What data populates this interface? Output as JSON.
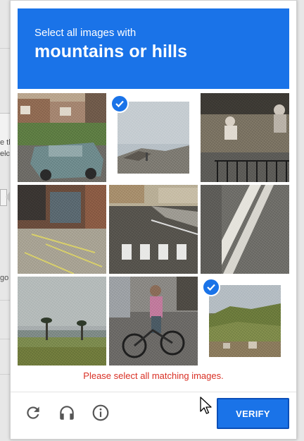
{
  "background": {
    "fragments": [
      "e th",
      "elc",
      "go"
    ]
  },
  "captcha": {
    "header": {
      "instruction": "Select all images with",
      "target": "mountains or hills",
      "color": "#1a73e8"
    },
    "tiles": [
      {
        "subject": "houses-street-car",
        "selected": false
      },
      {
        "subject": "rooftop-sky",
        "selected": true
      },
      {
        "subject": "people-motorcycle-fence",
        "selected": false
      },
      {
        "subject": "building-parking-lot",
        "selected": false
      },
      {
        "subject": "crosswalk-street",
        "selected": false
      },
      {
        "subject": "road-lane-markings",
        "selected": false
      },
      {
        "subject": "palm-trees-beach",
        "selected": false
      },
      {
        "subject": "person-bicycle",
        "selected": false
      },
      {
        "subject": "hillside-houses",
        "selected": true
      }
    ],
    "error_message": "Please select all matching images.",
    "error_color": "#d93025",
    "footer": {
      "reload_icon": "reload-icon",
      "audio_icon": "headphones-icon",
      "info_icon": "info-icon",
      "verify_label": "VERIFY"
    }
  }
}
